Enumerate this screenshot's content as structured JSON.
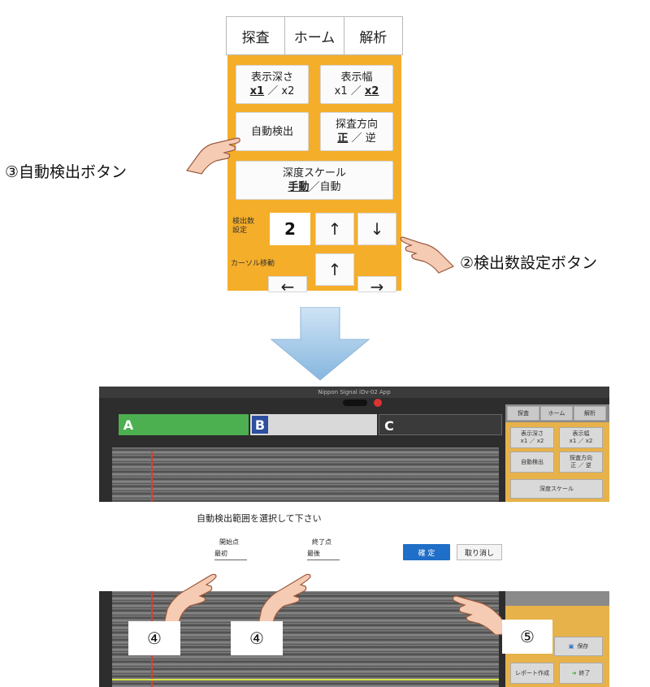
{
  "top_panel": {
    "tabs": [
      "探査",
      "ホーム",
      "解析"
    ],
    "depth_btn": {
      "title": "表示深さ",
      "opt1": "x1",
      "sep": "／",
      "opt2": "x2"
    },
    "width_btn": {
      "title": "表示幅",
      "opt1": "x1",
      "sep": "／",
      "opt2": "x2"
    },
    "auto_detect": "自動検出",
    "direction_btn": {
      "title": "探査方向",
      "opt1": "正",
      "sep": "／",
      "opt2": "逆"
    },
    "scale_btn": {
      "title": "深度スケール",
      "opt1": "手動",
      "sep": "／",
      "opt2": "自動"
    },
    "count_label_1": "検出数",
    "count_label_2": "設定",
    "count_value": "2",
    "up_arrow": "↑",
    "down_arrow": "↓",
    "cursor_label": "カーソル移動",
    "left_arrow": "←",
    "right_arrow": "→"
  },
  "callouts": {
    "auto_detect_button": "③自動検出ボタン",
    "count_setting_button": "②検出数設定ボタン",
    "start_badge": "④",
    "end_badge": "④",
    "confirm_badge": "⑤"
  },
  "app": {
    "title": "Nippon Signal iDv-02 App",
    "file_a_letter": "A",
    "file_b_letter": "B",
    "file_c_letter": "C",
    "dialog_title": "自動検出範囲を選択して下さい",
    "start_label": "開始点",
    "start_value": "最初",
    "end_label": "終了点",
    "end_value": "最後",
    "confirm": "確 定",
    "cancel": "取り消し",
    "right_tabs": [
      "探査",
      "ホーム",
      "解析"
    ],
    "rp_depth": "表示深さ",
    "rp_depth_opts": "x1 ／ x2",
    "rp_width": "表示幅",
    "rp_width_opts": "x1 ／ x2",
    "rp_auto": "自動検出",
    "rp_dir": "探査方向",
    "rp_dir_opts": "正 ／ 逆",
    "rp_scale": "深度スケール",
    "rp_save": "保存",
    "rp_report": "レポート作成",
    "rp_exit": "終了"
  },
  "colors": {
    "orange": "#f5ae29",
    "arrow_blue": "#a9cdea",
    "confirm_blue": "#1f6ec7",
    "green_file": "#3aa33a"
  }
}
